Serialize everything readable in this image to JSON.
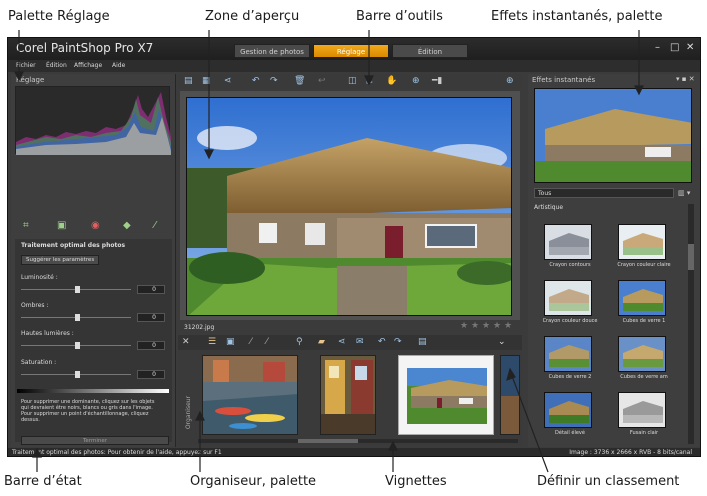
{
  "callouts": {
    "adjust_palette": "Palette Réglage",
    "preview_zone": "Zone d’aperçu",
    "toolbar": "Barre d’outils",
    "instant_effects": "Effets instantanés, palette",
    "status_bar": "Barre d’état",
    "organizer": "Organiseur, palette",
    "thumbnails": "Vignettes",
    "rating": "Définir un classement"
  },
  "app": {
    "title": "Corel PaintShop Pro X7",
    "tabs": [
      "Gestion de photos",
      "Réglage",
      "Édition"
    ],
    "active_tab_index": 1,
    "window_buttons": [
      "–",
      "□",
      "✕"
    ],
    "menu": [
      "Fichier",
      "Édition",
      "Affichage",
      "Aide"
    ]
  },
  "adjust_palette": {
    "title": "Réglage",
    "tool_icons": [
      "crop-icon",
      "straighten-icon",
      "red-eye-icon",
      "retouch-icon",
      "flatten-icon"
    ],
    "smart_photo_fix": {
      "heading": "Traitement optimal des photos",
      "suggest_button": "Suggérer les paramètres",
      "sliders": [
        {
          "label": "Luminosité :",
          "value": "0"
        },
        {
          "label": "Ombres :",
          "value": "0"
        },
        {
          "label": "Hautes lumières :",
          "value": "0"
        },
        {
          "label": "Saturation :",
          "value": "0"
        }
      ],
      "help_text": "Pour supprimer une dominante, cliquez sur les objets qui devraient être noirs, blancs ou gris dans l'image. Pour supprimer un point d'échantillonnage, cliquez dessus.",
      "apply_button": "Terminer"
    }
  },
  "preview": {
    "filename": "31202.jpg",
    "rating_stars": 5,
    "rating_value": 0
  },
  "organizer": {
    "label": "Organiseur",
    "selected_thumbnail_index": 2
  },
  "effects_palette": {
    "title": "Effets instantanés",
    "dropdown_value": "Tous",
    "category": "Artistique",
    "items": [
      "Crayon contours",
      "Crayon couleur claire",
      "Crayon couleur douce",
      "Cubes de verre 1",
      "Cubes de verre 2",
      "Cubes de verre am",
      "Détail élevé",
      "Fusain clair"
    ]
  },
  "status": {
    "left": "Traitement optimal des photos: Pour obtenir de l'aide, appuyez sur F1",
    "right": "Image : 3736 x 2666 x RVB - 8 bits/canal"
  },
  "colors": {
    "accent_tab": "#e8a012",
    "panel_bg": "#3e3e3e",
    "selected_thumb": "#f4f4f4"
  }
}
